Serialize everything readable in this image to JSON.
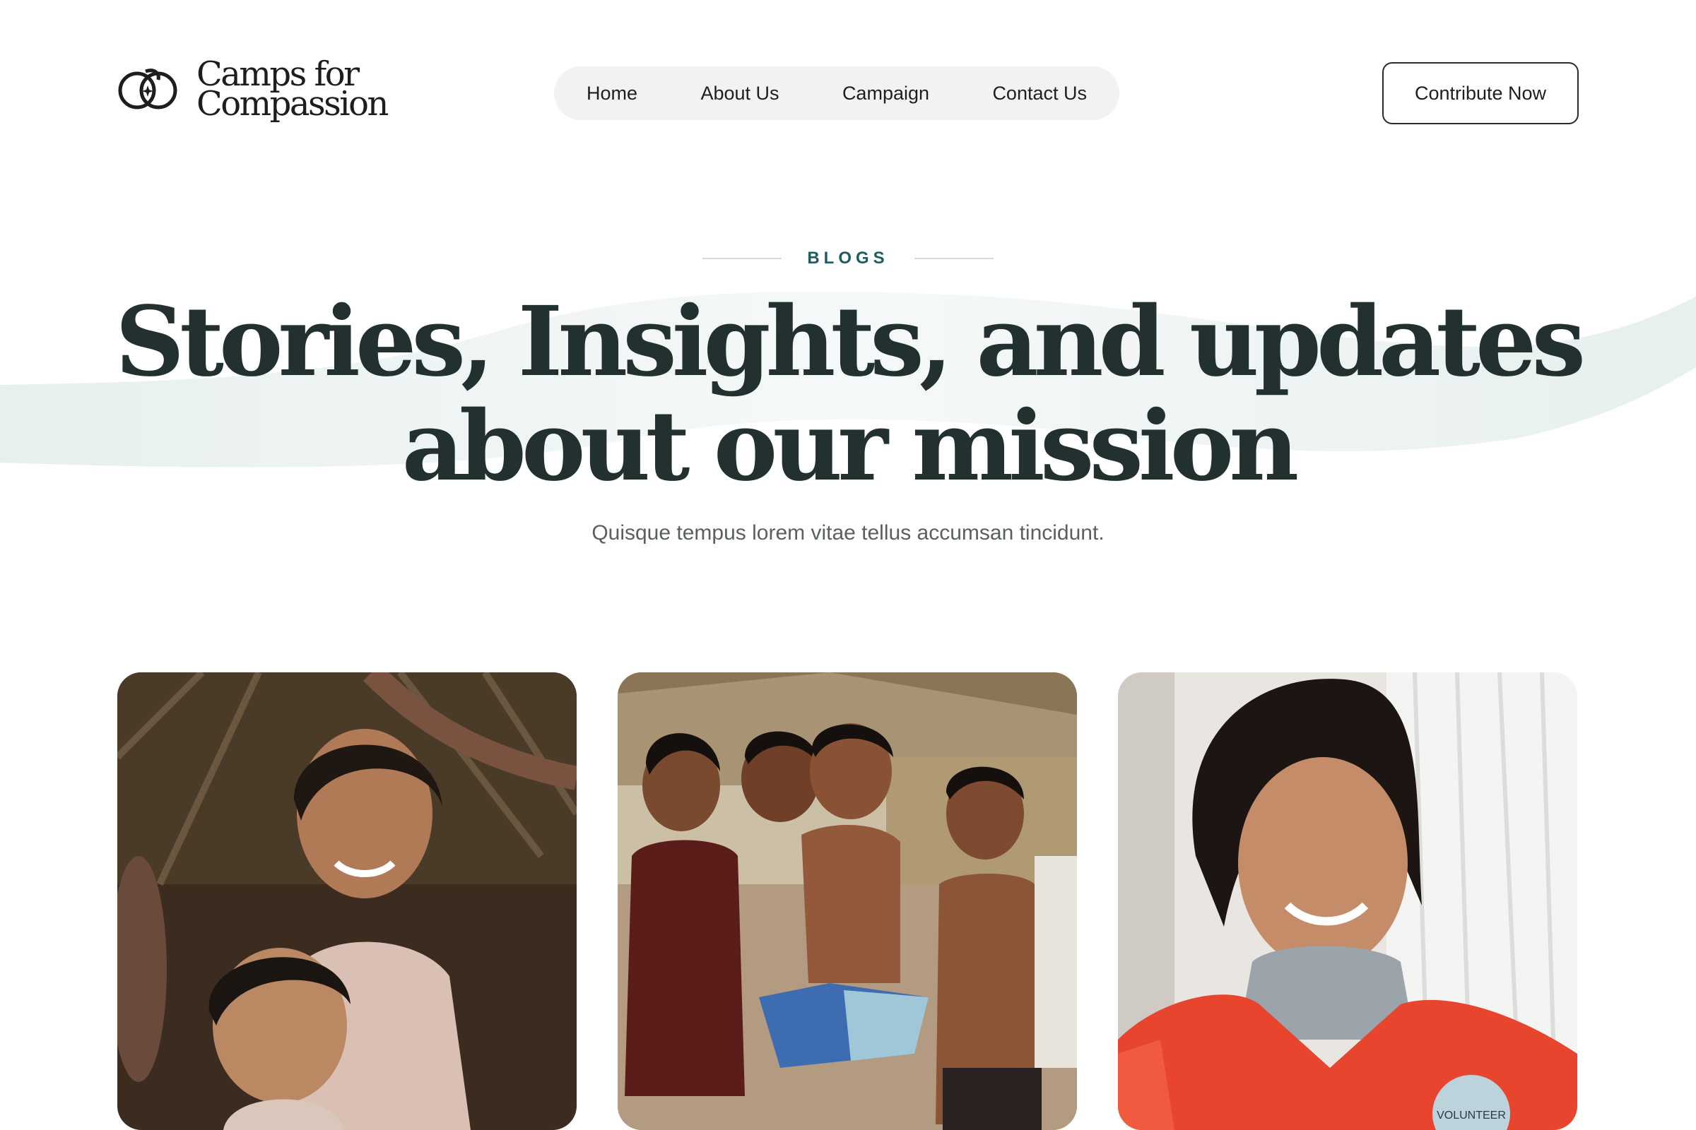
{
  "brand": {
    "name_line1": "Camps for",
    "name_line2": "Compassion",
    "icon": "logo-mark-icon"
  },
  "nav": {
    "items": [
      {
        "label": "Home"
      },
      {
        "label": "About Us"
      },
      {
        "label": "Campaign"
      },
      {
        "label": "Contact Us"
      }
    ]
  },
  "header": {
    "cta_label": "Contribute Now"
  },
  "hero": {
    "eyebrow": "BLOGS",
    "title_line1": "Stories, Insights, and updates",
    "title_line2": "about our mission",
    "subtitle": "Quisque tempus lorem vitae tellus accumsan tincidunt."
  },
  "cards": [
    {
      "image": "photo-smiling-girl-with-child"
    },
    {
      "image": "photo-group-of-boys"
    },
    {
      "image": "photo-volunteer-woman",
      "badge_text": "VOLUNTEER"
    }
  ],
  "colors": {
    "accent": "#1f5c60",
    "heading": "#22302f",
    "nav_bg": "#f1f2f2",
    "wave": "#e6efee"
  }
}
